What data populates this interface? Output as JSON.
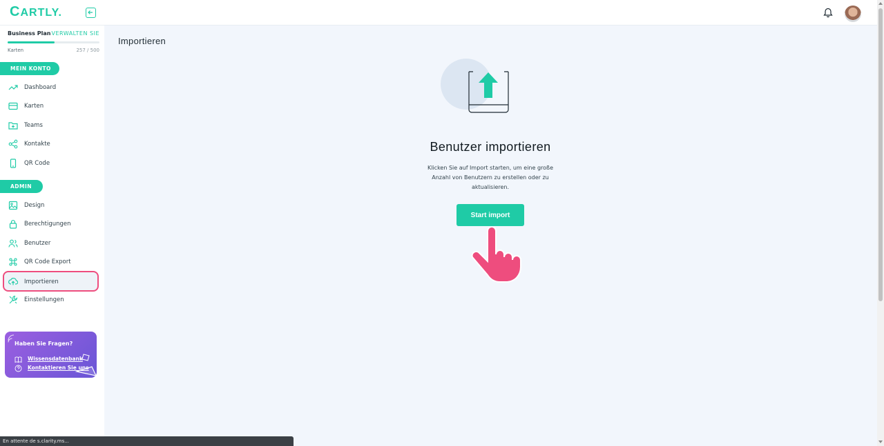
{
  "app": {
    "logo_text": "ARTLY.",
    "logo_initial": "C",
    "brand_color": "#1fcba6",
    "accent_color": "#ee4d7e"
  },
  "topbar": {
    "collapse_icon": "arrow-left-icon",
    "notification_icon": "bell-icon"
  },
  "plan": {
    "name": "Business Plan",
    "manage_label": "VERWALTEN SIE",
    "cards_label": "Karten",
    "cards_count": "257 / 500",
    "usage_fraction": 0.514
  },
  "sidebar": {
    "section_account": "MEIN KONTO",
    "account_items": [
      {
        "label": "Dashboard",
        "icon": "trending-up-icon"
      },
      {
        "label": "Karten",
        "icon": "credit-card-icon"
      },
      {
        "label": "Teams",
        "icon": "folder-plus-icon"
      },
      {
        "label": "Kontakte",
        "icon": "share-icon"
      },
      {
        "label": "QR Code",
        "icon": "phone-icon"
      }
    ],
    "section_admin": "ADMIN",
    "admin_items": [
      {
        "label": "Design",
        "icon": "image-icon"
      },
      {
        "label": "Berechtigungen",
        "icon": "lock-icon"
      },
      {
        "label": "Benutzer",
        "icon": "users-icon"
      },
      {
        "label": "QR Code Export",
        "icon": "command-icon"
      },
      {
        "label": "Importieren",
        "icon": "upload-cloud-icon",
        "active": true
      },
      {
        "label": "Einstellungen",
        "icon": "tools-icon"
      }
    ]
  },
  "help": {
    "title": "Haben Sie Fragen?",
    "knowledge_link": "Wissensdatenbank",
    "contact_link": "Kontaktieren Sie uns"
  },
  "main": {
    "page_title": "Importieren",
    "import_title": "Benutzer importieren",
    "import_description": "Klicken Sie auf Import starten, um eine große Anzahl von Benutzern zu erstellen oder zu aktualisieren.",
    "start_button": "Start import"
  },
  "statusbar": {
    "text": "En attente de s.clarity.ms..."
  }
}
